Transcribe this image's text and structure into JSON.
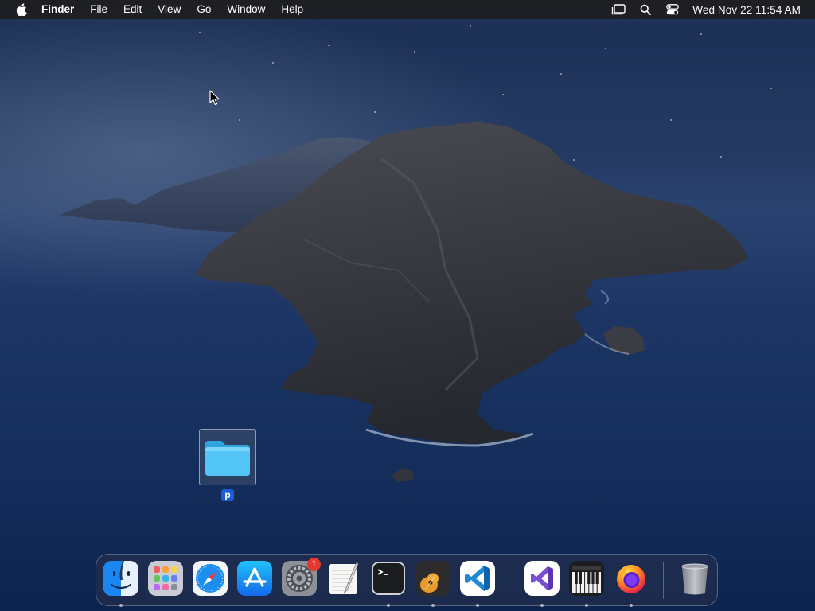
{
  "menubar": {
    "apple_icon": "apple-logo-icon",
    "app_name": "Finder",
    "menus": [
      "File",
      "Edit",
      "View",
      "Go",
      "Window",
      "Help"
    ],
    "status_icons": [
      "stage-manager-icon",
      "spotlight-search-icon",
      "control-center-icon"
    ],
    "clock": "Wed Nov 22  11:54 AM"
  },
  "desktop": {
    "items": [
      {
        "label": "p",
        "icon": "folder-icon",
        "selected": true,
        "color": "#4cc3f5"
      }
    ]
  },
  "dock": {
    "apps": [
      {
        "name": "finder",
        "icon": "finder-icon",
        "running": true
      },
      {
        "name": "launchpad",
        "icon": "launchpad-icon",
        "running": false
      },
      {
        "name": "safari",
        "icon": "safari-icon",
        "running": false
      },
      {
        "name": "app-store",
        "icon": "app-store-icon",
        "running": false
      },
      {
        "name": "system-settings",
        "icon": "system-settings-icon",
        "running": false,
        "badge": "1"
      },
      {
        "name": "textedit",
        "icon": "textedit-icon",
        "running": false
      },
      {
        "name": "terminal",
        "icon": "terminal-icon",
        "running": true
      },
      {
        "name": "garageband",
        "icon": "garageband-icon",
        "running": true
      },
      {
        "name": "visual-studio-code",
        "icon": "vscode-icon",
        "running": true
      },
      {
        "name": "visual-studio",
        "icon": "visual-studio-icon",
        "running": true
      },
      {
        "name": "piano-app",
        "icon": "piano-keys-icon",
        "running": true
      },
      {
        "name": "firefox",
        "icon": "firefox-icon",
        "running": true
      },
      {
        "name": "trash",
        "icon": "trash-icon",
        "running": false
      }
    ]
  },
  "colors": {
    "menubar": "#1e1e20",
    "selection": "#1a5bd7",
    "badge": "#e5382e",
    "folder": "#4cc3f5"
  }
}
